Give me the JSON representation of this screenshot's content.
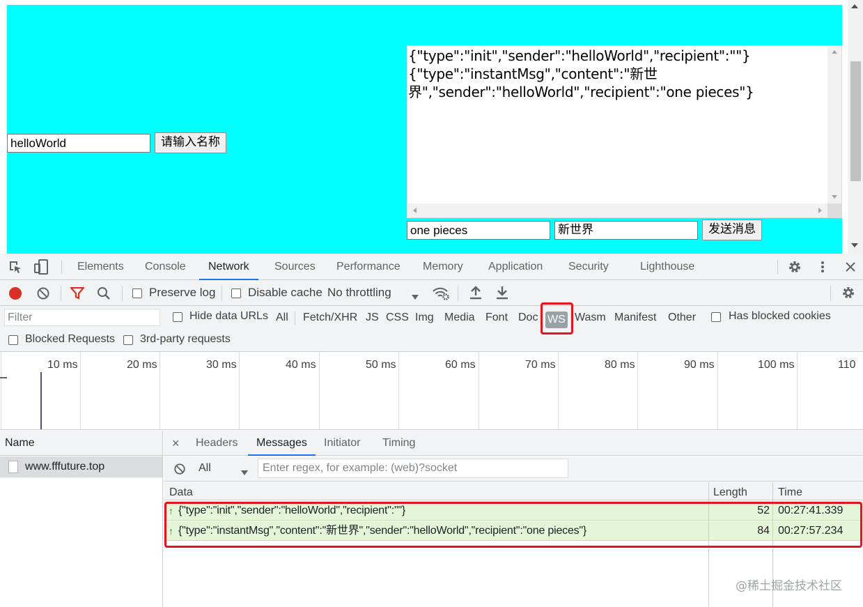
{
  "page": {
    "name_input_value": "helloWorld",
    "name_button": "请输入名称",
    "message_log": [
      "{\"type\":\"init\",\"sender\":\"helloWorld\",\"recipient\":\"\"}",
      "{\"type\":\"instantMsg\",\"content\":\"新世",
      "界\",\"sender\":\"helloWorld\",\"recipient\":\"one pieces\"}"
    ],
    "recipient_input_value": "one pieces",
    "content_input_value": "新世界",
    "send_button": "发送消息",
    "background_color": "#00ffff"
  },
  "devtools": {
    "tabs": [
      "Elements",
      "Console",
      "Network",
      "Sources",
      "Performance",
      "Memory",
      "Application",
      "Security",
      "Lighthouse"
    ],
    "active_tab": "Network",
    "toolbar": {
      "preserve_log": "Preserve log",
      "disable_cache": "Disable cache",
      "throttling": "No throttling"
    },
    "filter": {
      "placeholder": "Filter",
      "hide_data_urls": "Hide data URLs",
      "types": [
        "All",
        "Fetch/XHR",
        "JS",
        "CSS",
        "Img",
        "Media",
        "Font",
        "Doc",
        "WS",
        "Wasm",
        "Manifest",
        "Other"
      ],
      "active_type": "WS",
      "has_blocked_cookies": "Has blocked cookies",
      "blocked_requests": "Blocked Requests",
      "third_party": "3rd-party requests"
    },
    "overview_ticks": [
      "10 ms",
      "20 ms",
      "30 ms",
      "40 ms",
      "50 ms",
      "60 ms",
      "70 ms",
      "80 ms",
      "90 ms",
      "100 ms",
      "110"
    ],
    "requests": {
      "header": "Name",
      "items": [
        "www.fffuture.top"
      ]
    },
    "detail": {
      "close": "×",
      "tabs": [
        "Headers",
        "Messages",
        "Initiator",
        "Timing"
      ],
      "active_tab": "Messages",
      "message_filter": "All",
      "regex_placeholder": "Enter regex, for example: (web)?socket",
      "columns": [
        "Data",
        "Length",
        "Time"
      ],
      "messages": [
        {
          "direction": "↑",
          "data": "{\"type\":\"init\",\"sender\":\"helloWorld\",\"recipient\":\"\"}",
          "length": "52",
          "time": "00:27:41.339"
        },
        {
          "direction": "↑",
          "data": "{\"type\":\"instantMsg\",\"content\":\"新世界\",\"sender\":\"helloWorld\",\"recipient\":\"one pieces\"}",
          "length": "84",
          "time": "00:27:57.234"
        }
      ]
    }
  },
  "watermark": "@稀土掘金技术社区",
  "highlight_color": "#e3141e"
}
